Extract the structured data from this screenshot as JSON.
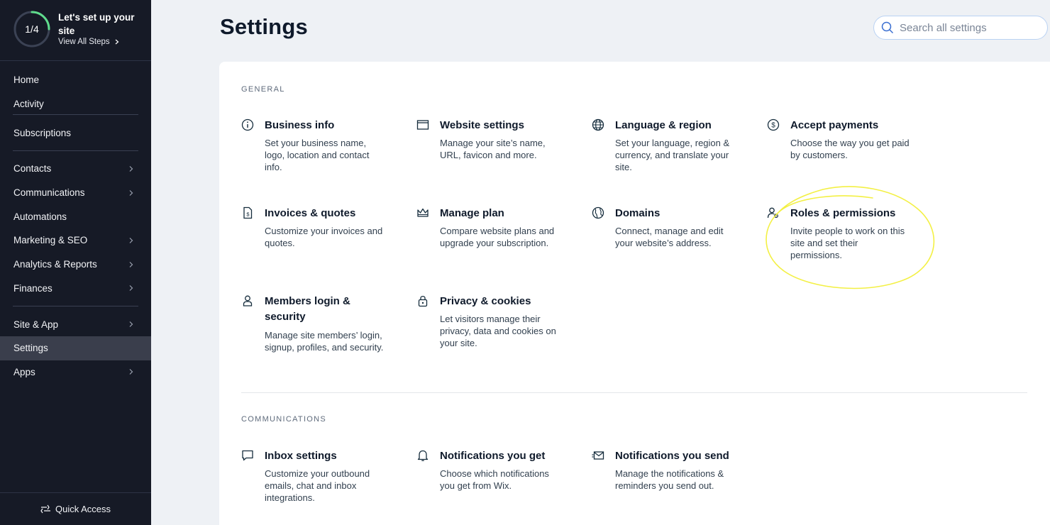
{
  "setup": {
    "progress": "1/4",
    "progress_fraction": 0.25,
    "title": "Let's set up your site",
    "link": "View All Steps"
  },
  "nav": {
    "home": "Home",
    "activity": "Activity",
    "subscriptions": "Subscriptions",
    "contacts": "Contacts",
    "communications": "Communications",
    "automations": "Automations",
    "marketing": "Marketing & SEO",
    "analytics": "Analytics & Reports",
    "finances": "Finances",
    "site_app": "Site & App",
    "settings": "Settings",
    "apps": "Apps"
  },
  "quick_access": "Quick Access",
  "page_title": "Settings",
  "search": {
    "placeholder": "Search all settings"
  },
  "general": {
    "label": "GENERAL",
    "items": [
      {
        "title": "Business info",
        "desc": "Set your business name, logo, location and contact info.",
        "icon": "info-icon"
      },
      {
        "title": "Website settings",
        "desc": "Manage your site’s name, URL, favicon and more.",
        "icon": "browser-window-icon"
      },
      {
        "title": "Language & region",
        "desc": "Set your language, region & currency, and translate your site.",
        "icon": "globe-icon"
      },
      {
        "title": "Accept payments",
        "desc": "Choose the way you get paid by customers.",
        "icon": "dollar-circle-icon"
      },
      {
        "title": "Invoices & quotes",
        "desc": "Customize your invoices and quotes.",
        "icon": "invoice-icon"
      },
      {
        "title": "Manage plan",
        "desc": "Compare website plans and upgrade your subscription.",
        "icon": "crown-icon"
      },
      {
        "title": "Domains",
        "desc": "Connect, manage and edit your website’s address.",
        "icon": "domain-globe-icon"
      },
      {
        "title": "Roles & permissions",
        "desc": "Invite people to work on this site and set their permissions.",
        "icon": "user-key-icon"
      },
      {
        "title": "Members login & security",
        "desc": "Manage site members’ login, signup, profiles, and security.",
        "icon": "person-icon"
      },
      {
        "title": "Privacy & cookies",
        "desc": "Let visitors manage their privacy, data and cookies on your site.",
        "icon": "lock-icon"
      }
    ]
  },
  "communications": {
    "label": "COMMUNICATIONS",
    "items": [
      {
        "title": "Inbox settings",
        "desc": "Customize your outbound emails, chat and inbox integrations.",
        "icon": "chat-bubble-icon"
      },
      {
        "title": "Notifications you get",
        "desc": "Choose which notifications you get from Wix.",
        "icon": "bell-icon"
      },
      {
        "title": "Notifications you send",
        "desc": "Manage the notifications & reminders you send out.",
        "icon": "envelope-send-icon"
      }
    ]
  },
  "colors": {
    "sidebar_bg": "#161a26",
    "ring_progress": "#5fdc8c",
    "highlight": "#f3f044"
  }
}
